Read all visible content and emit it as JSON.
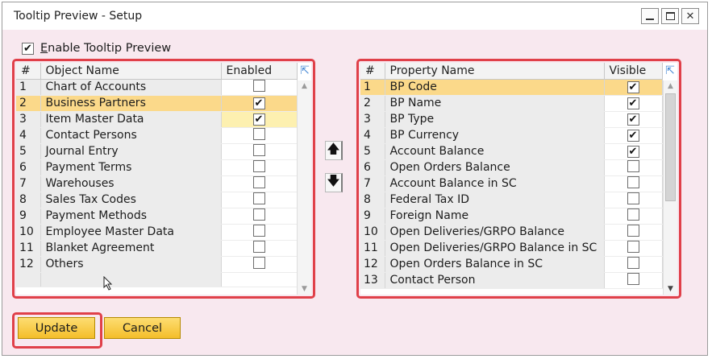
{
  "window": {
    "title": "Tooltip Preview - Setup"
  },
  "enable_tooltip": {
    "label_prefix": "",
    "label_underlined": "E",
    "label_rest": "nable Tooltip Preview",
    "checked": true
  },
  "objects_table": {
    "headers": {
      "num": "#",
      "name": "Object Name",
      "flag": "Enabled"
    },
    "rows": [
      {
        "num": "1",
        "name": "Chart of Accounts",
        "enabled": false
      },
      {
        "num": "2",
        "name": "Business Partners",
        "enabled": true
      },
      {
        "num": "3",
        "name": "Item Master Data",
        "enabled": true
      },
      {
        "num": "4",
        "name": "Contact Persons",
        "enabled": false
      },
      {
        "num": "5",
        "name": "Journal Entry",
        "enabled": false
      },
      {
        "num": "6",
        "name": "Payment Terms",
        "enabled": false
      },
      {
        "num": "7",
        "name": "Warehouses",
        "enabled": false
      },
      {
        "num": "8",
        "name": "Sales Tax Codes",
        "enabled": false
      },
      {
        "num": "9",
        "name": "Payment Methods",
        "enabled": false
      },
      {
        "num": "10",
        "name": "Employee Master Data",
        "enabled": false
      },
      {
        "num": "11",
        "name": "Blanket Agreement",
        "enabled": false
      },
      {
        "num": "12",
        "name": "Others",
        "enabled": false
      }
    ],
    "selected_row": 2
  },
  "properties_table": {
    "headers": {
      "num": "#",
      "name": "Property Name",
      "flag": "Visible"
    },
    "rows": [
      {
        "num": "1",
        "name": "BP Code",
        "visible": true
      },
      {
        "num": "2",
        "name": "BP Name",
        "visible": true
      },
      {
        "num": "3",
        "name": "BP Type",
        "visible": true
      },
      {
        "num": "4",
        "name": "BP Currency",
        "visible": true
      },
      {
        "num": "5",
        "name": "Account Balance",
        "visible": true
      },
      {
        "num": "6",
        "name": "Open Orders Balance",
        "visible": false
      },
      {
        "num": "7",
        "name": "Account Balance in SC",
        "visible": false
      },
      {
        "num": "8",
        "name": "Federal Tax ID",
        "visible": false
      },
      {
        "num": "9",
        "name": "Foreign Name",
        "visible": false
      },
      {
        "num": "10",
        "name": "Open Deliveries/GRPO Balance",
        "visible": false
      },
      {
        "num": "11",
        "name": "Open Deliveries/GRPO Balance in SC",
        "visible": false
      },
      {
        "num": "12",
        "name": "Open Orders Balance in SC",
        "visible": false
      },
      {
        "num": "13",
        "name": "Contact Person",
        "visible": false
      }
    ],
    "selected_row": 1
  },
  "buttons": {
    "update": "Update",
    "cancel": "Cancel"
  },
  "icons": {
    "check_glyph": "✔",
    "move_up": "🡅",
    "move_down": "🡇",
    "expand": "⇱"
  },
  "colors": {
    "highlight_frame": "#e04049",
    "selection": "#fbd98a",
    "button_gold": "#f4be2a",
    "window_bg": "#f8e8ef"
  }
}
